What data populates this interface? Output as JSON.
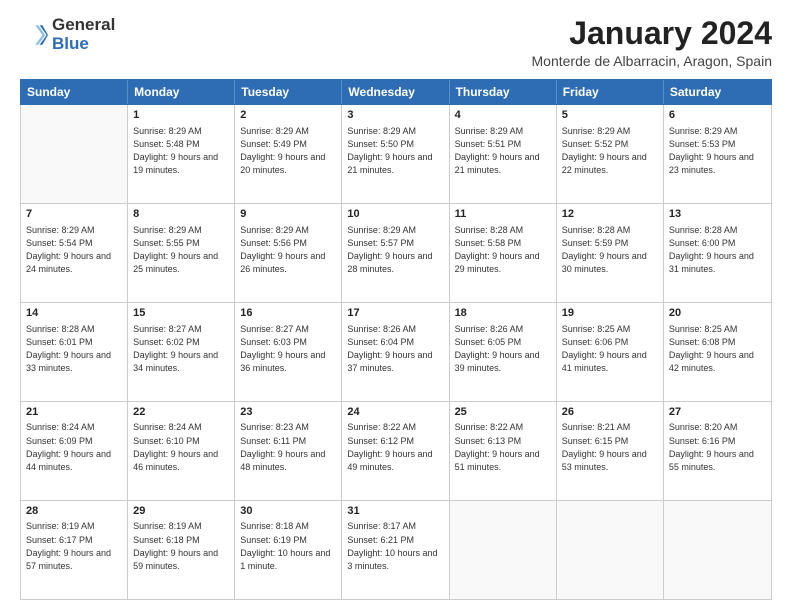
{
  "logo": {
    "general": "General",
    "blue": "Blue"
  },
  "title": "January 2024",
  "location": "Monterde de Albarracin, Aragon, Spain",
  "weekdays": [
    "Sunday",
    "Monday",
    "Tuesday",
    "Wednesday",
    "Thursday",
    "Friday",
    "Saturday"
  ],
  "weeks": [
    [
      {
        "day": "",
        "sunrise": "",
        "sunset": "",
        "daylight": ""
      },
      {
        "day": "1",
        "sunrise": "Sunrise: 8:29 AM",
        "sunset": "Sunset: 5:48 PM",
        "daylight": "Daylight: 9 hours and 19 minutes."
      },
      {
        "day": "2",
        "sunrise": "Sunrise: 8:29 AM",
        "sunset": "Sunset: 5:49 PM",
        "daylight": "Daylight: 9 hours and 20 minutes."
      },
      {
        "day": "3",
        "sunrise": "Sunrise: 8:29 AM",
        "sunset": "Sunset: 5:50 PM",
        "daylight": "Daylight: 9 hours and 21 minutes."
      },
      {
        "day": "4",
        "sunrise": "Sunrise: 8:29 AM",
        "sunset": "Sunset: 5:51 PM",
        "daylight": "Daylight: 9 hours and 21 minutes."
      },
      {
        "day": "5",
        "sunrise": "Sunrise: 8:29 AM",
        "sunset": "Sunset: 5:52 PM",
        "daylight": "Daylight: 9 hours and 22 minutes."
      },
      {
        "day": "6",
        "sunrise": "Sunrise: 8:29 AM",
        "sunset": "Sunset: 5:53 PM",
        "daylight": "Daylight: 9 hours and 23 minutes."
      }
    ],
    [
      {
        "day": "7",
        "sunrise": "Sunrise: 8:29 AM",
        "sunset": "Sunset: 5:54 PM",
        "daylight": "Daylight: 9 hours and 24 minutes."
      },
      {
        "day": "8",
        "sunrise": "Sunrise: 8:29 AM",
        "sunset": "Sunset: 5:55 PM",
        "daylight": "Daylight: 9 hours and 25 minutes."
      },
      {
        "day": "9",
        "sunrise": "Sunrise: 8:29 AM",
        "sunset": "Sunset: 5:56 PM",
        "daylight": "Daylight: 9 hours and 26 minutes."
      },
      {
        "day": "10",
        "sunrise": "Sunrise: 8:29 AM",
        "sunset": "Sunset: 5:57 PM",
        "daylight": "Daylight: 9 hours and 28 minutes."
      },
      {
        "day": "11",
        "sunrise": "Sunrise: 8:28 AM",
        "sunset": "Sunset: 5:58 PM",
        "daylight": "Daylight: 9 hours and 29 minutes."
      },
      {
        "day": "12",
        "sunrise": "Sunrise: 8:28 AM",
        "sunset": "Sunset: 5:59 PM",
        "daylight": "Daylight: 9 hours and 30 minutes."
      },
      {
        "day": "13",
        "sunrise": "Sunrise: 8:28 AM",
        "sunset": "Sunset: 6:00 PM",
        "daylight": "Daylight: 9 hours and 31 minutes."
      }
    ],
    [
      {
        "day": "14",
        "sunrise": "Sunrise: 8:28 AM",
        "sunset": "Sunset: 6:01 PM",
        "daylight": "Daylight: 9 hours and 33 minutes."
      },
      {
        "day": "15",
        "sunrise": "Sunrise: 8:27 AM",
        "sunset": "Sunset: 6:02 PM",
        "daylight": "Daylight: 9 hours and 34 minutes."
      },
      {
        "day": "16",
        "sunrise": "Sunrise: 8:27 AM",
        "sunset": "Sunset: 6:03 PM",
        "daylight": "Daylight: 9 hours and 36 minutes."
      },
      {
        "day": "17",
        "sunrise": "Sunrise: 8:26 AM",
        "sunset": "Sunset: 6:04 PM",
        "daylight": "Daylight: 9 hours and 37 minutes."
      },
      {
        "day": "18",
        "sunrise": "Sunrise: 8:26 AM",
        "sunset": "Sunset: 6:05 PM",
        "daylight": "Daylight: 9 hours and 39 minutes."
      },
      {
        "day": "19",
        "sunrise": "Sunrise: 8:25 AM",
        "sunset": "Sunset: 6:06 PM",
        "daylight": "Daylight: 9 hours and 41 minutes."
      },
      {
        "day": "20",
        "sunrise": "Sunrise: 8:25 AM",
        "sunset": "Sunset: 6:08 PM",
        "daylight": "Daylight: 9 hours and 42 minutes."
      }
    ],
    [
      {
        "day": "21",
        "sunrise": "Sunrise: 8:24 AM",
        "sunset": "Sunset: 6:09 PM",
        "daylight": "Daylight: 9 hours and 44 minutes."
      },
      {
        "day": "22",
        "sunrise": "Sunrise: 8:24 AM",
        "sunset": "Sunset: 6:10 PM",
        "daylight": "Daylight: 9 hours and 46 minutes."
      },
      {
        "day": "23",
        "sunrise": "Sunrise: 8:23 AM",
        "sunset": "Sunset: 6:11 PM",
        "daylight": "Daylight: 9 hours and 48 minutes."
      },
      {
        "day": "24",
        "sunrise": "Sunrise: 8:22 AM",
        "sunset": "Sunset: 6:12 PM",
        "daylight": "Daylight: 9 hours and 49 minutes."
      },
      {
        "day": "25",
        "sunrise": "Sunrise: 8:22 AM",
        "sunset": "Sunset: 6:13 PM",
        "daylight": "Daylight: 9 hours and 51 minutes."
      },
      {
        "day": "26",
        "sunrise": "Sunrise: 8:21 AM",
        "sunset": "Sunset: 6:15 PM",
        "daylight": "Daylight: 9 hours and 53 minutes."
      },
      {
        "day": "27",
        "sunrise": "Sunrise: 8:20 AM",
        "sunset": "Sunset: 6:16 PM",
        "daylight": "Daylight: 9 hours and 55 minutes."
      }
    ],
    [
      {
        "day": "28",
        "sunrise": "Sunrise: 8:19 AM",
        "sunset": "Sunset: 6:17 PM",
        "daylight": "Daylight: 9 hours and 57 minutes."
      },
      {
        "day": "29",
        "sunrise": "Sunrise: 8:19 AM",
        "sunset": "Sunset: 6:18 PM",
        "daylight": "Daylight: 9 hours and 59 minutes."
      },
      {
        "day": "30",
        "sunrise": "Sunrise: 8:18 AM",
        "sunset": "Sunset: 6:19 PM",
        "daylight": "Daylight: 10 hours and 1 minute."
      },
      {
        "day": "31",
        "sunrise": "Sunrise: 8:17 AM",
        "sunset": "Sunset: 6:21 PM",
        "daylight": "Daylight: 10 hours and 3 minutes."
      },
      {
        "day": "",
        "sunrise": "",
        "sunset": "",
        "daylight": ""
      },
      {
        "day": "",
        "sunrise": "",
        "sunset": "",
        "daylight": ""
      },
      {
        "day": "",
        "sunrise": "",
        "sunset": "",
        "daylight": ""
      }
    ]
  ]
}
